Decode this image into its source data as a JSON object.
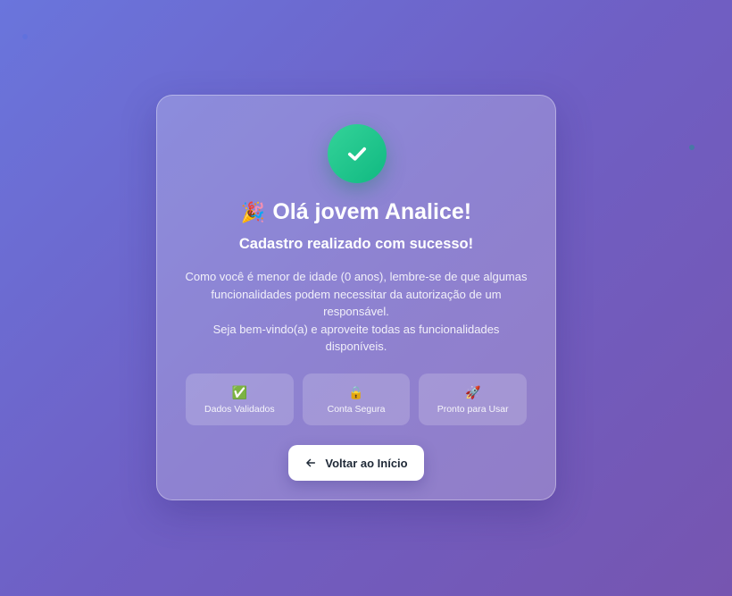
{
  "card": {
    "greeting_icon": "🎉",
    "greeting": "Olá jovem Analice!",
    "subtitle": "Cadastro realizado com sucesso!",
    "message_line1": "Como você é menor de idade (0 anos), lembre-se de que algumas funcionalidades podem necessitar da autorização de um responsável.",
    "message_line2": "Seja bem-vindo(a) e aproveite todas as funcionalidades disponíveis."
  },
  "features": [
    {
      "icon": "✅",
      "icon_name": "check-box-icon",
      "label": "Dados Validados"
    },
    {
      "icon": "🔒",
      "icon_name": "lock-icon",
      "label": "Conta Segura"
    },
    {
      "icon": "🚀",
      "icon_name": "rocket-icon",
      "label": "Pronto para Usar"
    }
  ],
  "back_button": {
    "label": "Voltar ao Início",
    "icon": "arrow-left-icon"
  },
  "colors": {
    "success": "#10b981",
    "background_start": "#6a75dc",
    "background_end": "#7655b0",
    "button_text": "#1f2937"
  }
}
